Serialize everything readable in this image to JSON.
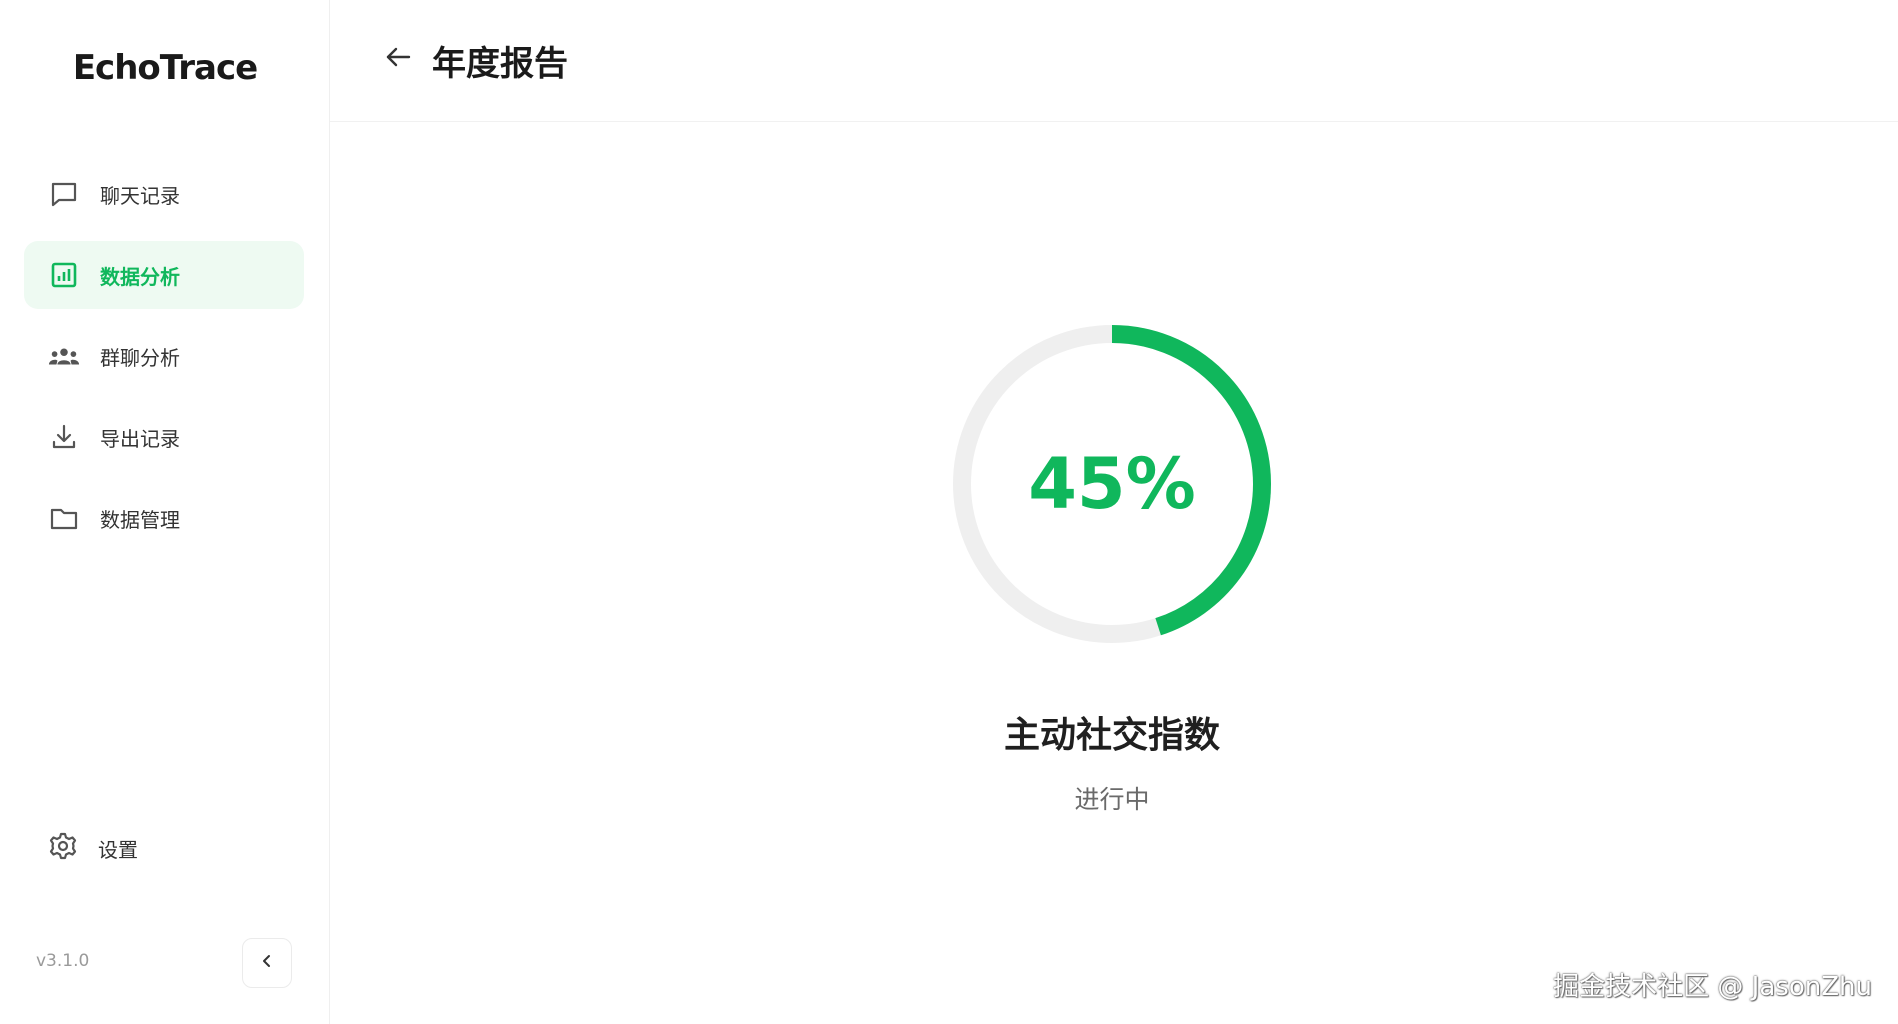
{
  "app": {
    "brand": "EchoTrace",
    "version": "v3.1.0"
  },
  "sidebar": {
    "items": [
      {
        "label": "聊天记录",
        "icon": "chat-bubble-icon",
        "active": false
      },
      {
        "label": "数据分析",
        "icon": "bar-chart-icon",
        "active": true
      },
      {
        "label": "群聊分析",
        "icon": "group-icon",
        "active": false
      },
      {
        "label": "导出记录",
        "icon": "download-icon",
        "active": false
      },
      {
        "label": "数据管理",
        "icon": "folder-icon",
        "active": false
      }
    ],
    "settings_label": "设置",
    "settings_icon": "gear-icon",
    "collapse_icon": "chevron-left-icon"
  },
  "header": {
    "title": "年度报告",
    "back_icon": "arrow-left-icon"
  },
  "metric": {
    "progress": 0.45,
    "percent_label": "45%",
    "title": "主动社交指数",
    "status": "进行中"
  },
  "watermark": "掘金技术社区 @ JasonZhu",
  "colors": {
    "accent": "#10b75c",
    "accent_bg": "#eefaf2",
    "track": "#efefef",
    "text": "#1f1f1f",
    "muted": "#6a6a6a"
  }
}
